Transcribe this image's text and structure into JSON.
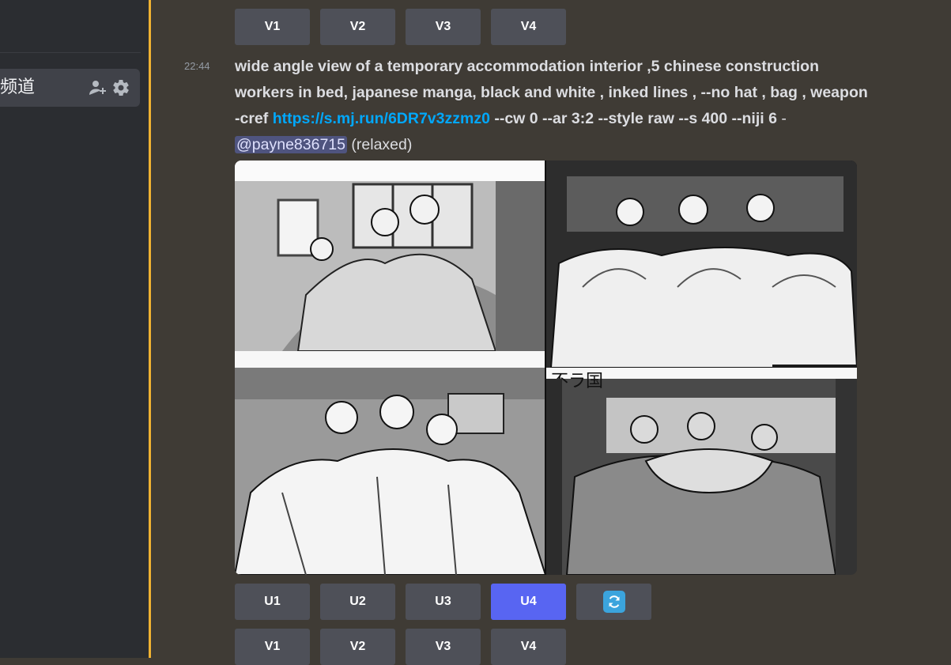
{
  "sidebar": {
    "channel_name": "频道"
  },
  "top_buttons": [
    "V1",
    "V2",
    "V3",
    "V4"
  ],
  "message": {
    "timestamp": "22:44",
    "prompt_line1": "wide angle view of a temporary accommodation interior ,5 chinese construction",
    "prompt_line2": "workers in bed, japanese manga, black and white , inked lines , --no hat , bag , weapon",
    "prompt_line3_pre": "-cref ",
    "prompt_link": "https://s.mj.run/6DR7v3zzmz0",
    "prompt_line3_post": " --cw 0 --ar 3:2 --style raw --s 400 --niji 6",
    "prompt_dash": " - ",
    "mention": "@payne836715",
    "status": " (relaxed)"
  },
  "image": {
    "alt_text": "不ラ国"
  },
  "upscale_buttons": [
    {
      "label": "U1",
      "active": false
    },
    {
      "label": "U2",
      "active": false
    },
    {
      "label": "U3",
      "active": false
    },
    {
      "label": "U4",
      "active": true
    }
  ],
  "reroll_button_icon": "refresh-icon",
  "variation_buttons": [
    "V1",
    "V2",
    "V3",
    "V4"
  ],
  "colors": {
    "accent": "#5865f2",
    "link": "#00a8fc",
    "mention_bg": "#4f547f",
    "new_message_bar": "#f0b232"
  }
}
